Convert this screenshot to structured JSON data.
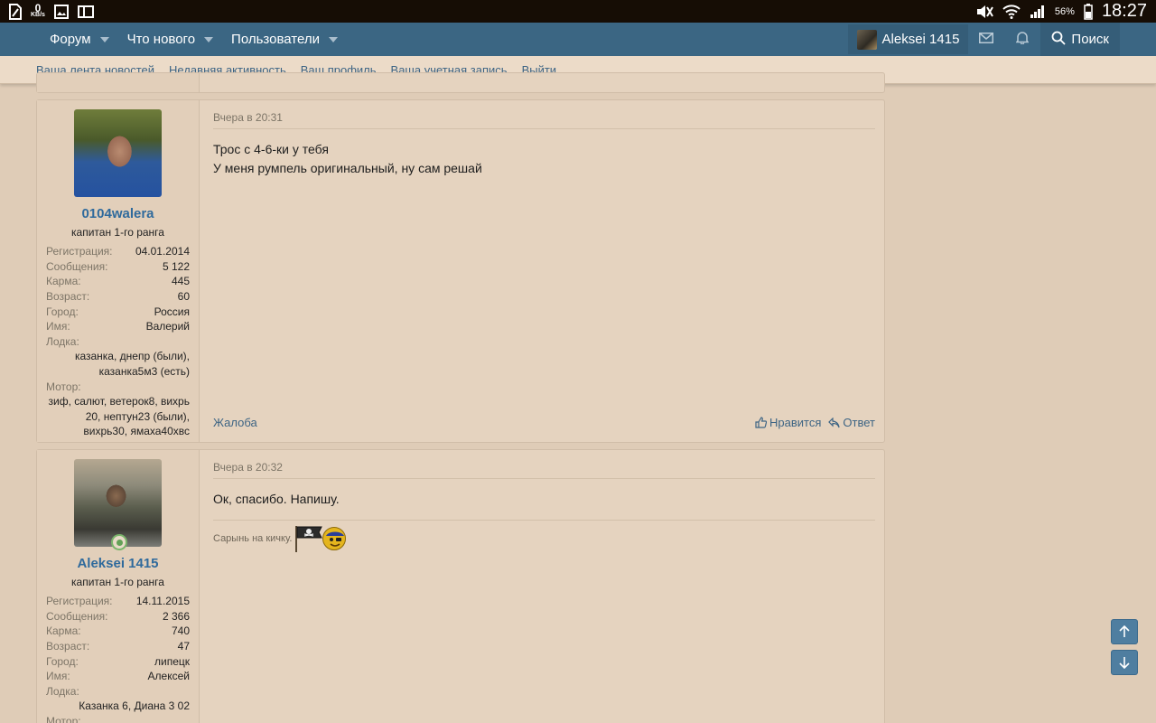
{
  "status_bar": {
    "speed_value": "0",
    "speed_unit": "KB/s",
    "battery_percent": "56%",
    "time": "18:27"
  },
  "nav": {
    "items": [
      "Форум",
      "Что нового",
      "Пользователи"
    ],
    "user_name": "Aleksei 1415",
    "search_label": "Поиск"
  },
  "subnav": {
    "links": [
      "Ваша лента новостей",
      "Недавняя активность",
      "Ваш профиль",
      "Ваша учетная запись",
      "Выйти"
    ]
  },
  "posts": [
    {
      "username": "0104walera",
      "rank": "капитан 1-го ранга",
      "info": [
        {
          "k": "Регистрация:",
          "v": "04.01.2014"
        },
        {
          "k": "Сообщения:",
          "v": "5 122"
        },
        {
          "k": "Карма:",
          "v": "445"
        },
        {
          "k": "Возраст:",
          "v": "60"
        },
        {
          "k": "Город:",
          "v": "Россия"
        },
        {
          "k": "Имя:",
          "v": "Валерий"
        }
      ],
      "boat_label": "Лодка:",
      "boat_lines": [
        "казанка, днепр (были),",
        "казанка5м3 (есть)"
      ],
      "motor_label": "Мотор:",
      "motor_lines": [
        "зиф, салют, ветерок8, вихрь",
        "20, нептун23 (были),",
        "вихрь30, ямаха40хвс"
      ],
      "date": "Вчера в 20:31",
      "body_lines": [
        "Трос с 4-6-ки у тебя",
        "У меня румпель оригинальный, ну сам решай"
      ],
      "report": "Жалоба",
      "like": "Нравится",
      "reply": "Ответ"
    },
    {
      "username": "Aleksei 1415",
      "rank": "капитан 1-го ранга",
      "info": [
        {
          "k": "Регистрация:",
          "v": "14.11.2015"
        },
        {
          "k": "Сообщения:",
          "v": "2 366"
        },
        {
          "k": "Карма:",
          "v": "740"
        },
        {
          "k": "Возраст:",
          "v": "47"
        },
        {
          "k": "Город:",
          "v": "липецк"
        },
        {
          "k": "Имя:",
          "v": "Алексей"
        }
      ],
      "boat_label": "Лодка:",
      "boat_lines": [
        "Казанка 6, Диана 3 02"
      ],
      "motor_label": "Мотор:",
      "date": "Вчера в 20:32",
      "body_lines": [
        "Ок, спасибо. Напишу."
      ],
      "signature": "Сарынь на кичку."
    }
  ],
  "colors": {
    "nav_bg": "#3b6683",
    "page_bg": "#dfccb7",
    "link": "#3d6484",
    "username": "#2f6a9c"
  }
}
